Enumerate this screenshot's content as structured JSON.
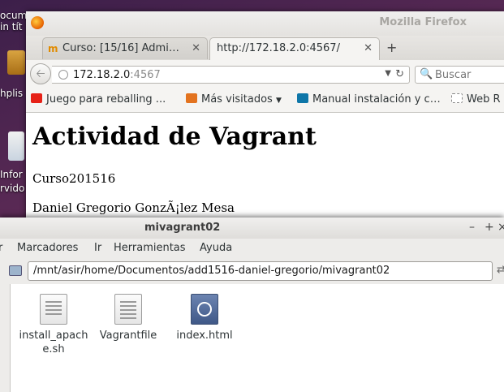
{
  "desktop": {
    "labels": [
      "ocumento",
      "in tít",
      "hplis",
      "Infor",
      "rvido"
    ]
  },
  "firefox": {
    "window_title": "Mozilla Firefox",
    "tabs": [
      {
        "label": "Curso: [15/16] Admi…",
        "favicon": "moodle-icon"
      },
      {
        "label": "http://172.18.2.0:4567/",
        "favicon": ""
      }
    ],
    "new_tab": "+",
    "url_host": "172.18.2.0",
    "url_port": ":4567",
    "search_placeholder": "Buscar",
    "bookmarks": [
      {
        "label": "Juego para reballing ...",
        "icon": "youtube-icon",
        "color": "#e62117"
      },
      {
        "label": "Más visitados",
        "icon": "rss-icon",
        "color": "#e3731f"
      },
      {
        "label": "Manual instalación y c…",
        "icon": "linkedin-icon",
        "color": "#0e76a8"
      },
      {
        "label": "Web R",
        "icon": "page-icon",
        "color": "#ffffff"
      }
    ],
    "page": {
      "heading": "Actividad de Vagrant",
      "line1": "Curso201516",
      "line2": "Daniel Gregorio GonzÃ¡lez Mesa"
    }
  },
  "filemanager": {
    "window_title": "mivagrant02",
    "wm": {
      "minimize": "–",
      "maximize": "+",
      "close": "×"
    },
    "menu": [
      "er",
      "Marcadores",
      "Ir",
      "Herramientas",
      "Ayuda"
    ],
    "location": "/mnt/asir/home/Documentos/add1516-daniel-gregorio/mivagrant02",
    "files": [
      {
        "name": "install_apache.sh",
        "icon": "shell-script-icon"
      },
      {
        "name": "Vagrantfile",
        "icon": "text-file-icon"
      },
      {
        "name": "index.html",
        "icon": "html-file-icon"
      }
    ]
  }
}
